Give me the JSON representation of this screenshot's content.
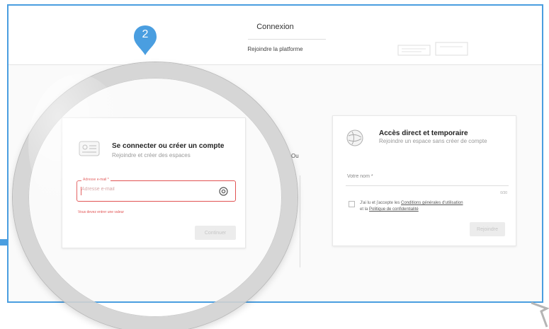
{
  "header": {
    "title": "Connexion",
    "subtitle": "Rejoindre la platforme"
  },
  "step": {
    "number": "2",
    "color": "#4a9ee0"
  },
  "login_card": {
    "title": "Se connecter ou créer un compte",
    "subtitle": "Rejoindre et créer des espaces",
    "email_label": "Adresse e-mail *",
    "email_placeholder": "Adresse e-mail",
    "error_text": "Vous devez entrer une valeur",
    "continue_label": "Continuer"
  },
  "separator": {
    "label": "Ou"
  },
  "guest_card": {
    "title": "Accès direct et temporaire",
    "subtitle": "Rejoindre un espace sans créer de compte",
    "name_label": "Votre nom *",
    "counter": "0/30",
    "terms_prefix": "J'ai lu et j'accepte les",
    "terms_link": "Conditions générales d'utilisation",
    "terms_middle": "et la",
    "privacy_link": "Politique de confidentialité",
    "join_label": "Rejoindre"
  },
  "colors": {
    "accent": "#4a9ee0",
    "error": "#e15353"
  }
}
